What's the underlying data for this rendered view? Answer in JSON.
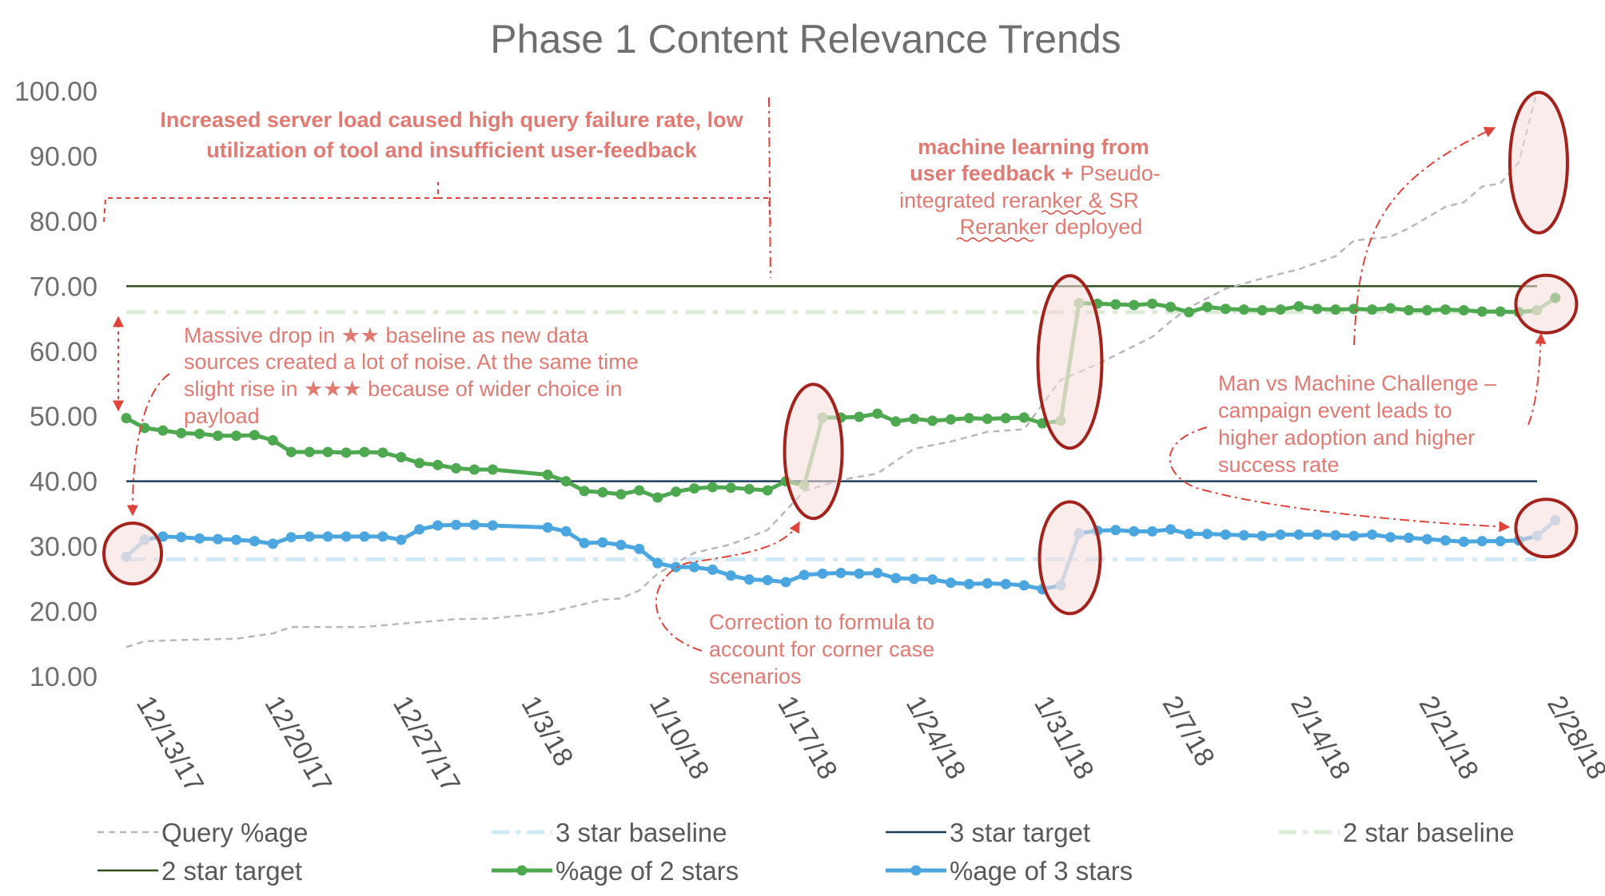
{
  "colors": {
    "query": "#b8b8b8",
    "star3_baseline": "#cfe9f6",
    "star3_target": "#1f3e5e",
    "star2_baseline": "#dcebd5",
    "star2_target": "#2d4d1d",
    "star2": "#4ea84f",
    "star2_light": "#9dcb93",
    "star3": "#4ba6e0",
    "star3_light": "#a8cfeb",
    "annotation": "#e07a72",
    "highlight_stroke": "#a3221c",
    "highlight_fill": "#f4dcdb"
  },
  "chart_data": {
    "type": "line",
    "title": "Phase 1 Content Relevance Trends",
    "xlabel": "",
    "ylabel": "",
    "ylim": [
      10,
      100
    ],
    "y_ticks": [
      "10.00",
      "20.00",
      "30.00",
      "40.00",
      "50.00",
      "60.00",
      "70.00",
      "80.00",
      "90.00",
      "100.00"
    ],
    "x_start": "2017-12-13",
    "x_end": "2018-02-28",
    "x_tick_labels": [
      "12/13/17",
      "12/20/17",
      "12/27/17",
      "1/3/18",
      "1/10/18",
      "1/17/18",
      "1/24/18",
      "1/31/18",
      "2/7/18",
      "2/14/18",
      "2/21/18",
      "2/28/18"
    ],
    "grid": false,
    "legend_position": "bottom",
    "series": [
      {
        "name": "Query %age",
        "style": "dashed",
        "points": [
          [
            "2017-12-13",
            14.5
          ],
          [
            "2017-12-14",
            15.4
          ],
          [
            "2017-12-16",
            15.6
          ],
          [
            "2017-12-19",
            15.8
          ],
          [
            "2017-12-21",
            16.6
          ],
          [
            "2017-12-22",
            17.6
          ],
          [
            "2017-12-26",
            17.6
          ],
          [
            "2017-12-28",
            18.1
          ],
          [
            "2017-12-31",
            18.8
          ],
          [
            "2018-01-02",
            18.9
          ],
          [
            "2018-01-05",
            19.8
          ],
          [
            "2018-01-08",
            21.8
          ],
          [
            "2018-01-09",
            22.0
          ],
          [
            "2018-01-10",
            23.2
          ],
          [
            "2018-01-11",
            25.8
          ],
          [
            "2018-01-13",
            29.0
          ],
          [
            "2018-01-15",
            30.3
          ],
          [
            "2018-01-17",
            32.5
          ],
          [
            "2018-01-19",
            38.5
          ],
          [
            "2018-01-21",
            40.2
          ],
          [
            "2018-01-23",
            41.2
          ],
          [
            "2018-01-25",
            45.0
          ],
          [
            "2018-01-27",
            46.1
          ],
          [
            "2018-01-29",
            47.6
          ],
          [
            "2018-01-31",
            48.0
          ],
          [
            "2018-02-02",
            55.6
          ],
          [
            "2018-02-04",
            58.0
          ],
          [
            "2018-02-05",
            59.4
          ],
          [
            "2018-02-07",
            62.2
          ],
          [
            "2018-02-08",
            64.6
          ],
          [
            "2018-02-09",
            66.7
          ],
          [
            "2018-02-11",
            69.6
          ],
          [
            "2018-02-13",
            71.2
          ],
          [
            "2018-02-15",
            72.6
          ],
          [
            "2018-02-17",
            74.6
          ],
          [
            "2018-02-18",
            77.0
          ],
          [
            "2018-02-20",
            77.6
          ],
          [
            "2018-02-21",
            78.9
          ],
          [
            "2018-02-23",
            82.2
          ],
          [
            "2018-02-24",
            82.9
          ],
          [
            "2018-02-25",
            85.3
          ],
          [
            "2018-02-26",
            85.8
          ],
          [
            "2018-02-27",
            89.0
          ],
          [
            "2018-02-28",
            100.0
          ]
        ]
      },
      {
        "name": "%age of 2 stars",
        "points": [
          [
            "2017-12-13",
            49.7
          ],
          [
            "2017-12-14",
            48.2
          ],
          [
            "2017-12-15",
            47.8
          ],
          [
            "2017-12-16",
            47.4
          ],
          [
            "2017-12-17",
            47.3
          ],
          [
            "2017-12-18",
            47.0
          ],
          [
            "2017-12-19",
            47.0
          ],
          [
            "2017-12-20",
            47.1
          ],
          [
            "2017-12-21",
            46.3
          ],
          [
            "2017-12-22",
            44.5
          ],
          [
            "2017-12-23",
            44.5
          ],
          [
            "2017-12-24",
            44.5
          ],
          [
            "2017-12-25",
            44.4
          ],
          [
            "2017-12-26",
            44.5
          ],
          [
            "2017-12-27",
            44.4
          ],
          [
            "2017-12-28",
            43.7
          ],
          [
            "2017-12-29",
            42.8
          ],
          [
            "2017-12-30",
            42.5
          ],
          [
            "2017-12-31",
            42.0
          ],
          [
            "2018-01-01",
            41.8
          ],
          [
            "2018-01-02",
            41.8
          ],
          [
            "2018-01-05",
            41.0
          ],
          [
            "2018-01-06",
            40.0
          ],
          [
            "2018-01-07",
            38.5
          ],
          [
            "2018-01-08",
            38.3
          ],
          [
            "2018-01-09",
            38.0
          ],
          [
            "2018-01-10",
            38.6
          ],
          [
            "2018-01-11",
            37.5
          ],
          [
            "2018-01-12",
            38.4
          ],
          [
            "2018-01-13",
            38.9
          ],
          [
            "2018-01-14",
            39.1
          ],
          [
            "2018-01-15",
            39.0
          ],
          [
            "2018-01-16",
            38.8
          ],
          [
            "2018-01-17",
            38.6
          ],
          [
            "2018-01-18",
            40.0
          ],
          [
            "2018-01-19",
            39.4
          ],
          [
            "2018-01-20",
            49.8
          ],
          [
            "2018-01-21",
            49.8
          ],
          [
            "2018-01-22",
            49.9
          ],
          [
            "2018-01-23",
            50.4
          ],
          [
            "2018-01-24",
            49.2
          ],
          [
            "2018-01-25",
            49.6
          ],
          [
            "2018-01-26",
            49.3
          ],
          [
            "2018-01-27",
            49.5
          ],
          [
            "2018-01-28",
            49.7
          ],
          [
            "2018-01-29",
            49.6
          ],
          [
            "2018-01-30",
            49.7
          ],
          [
            "2018-01-31",
            49.8
          ],
          [
            "2018-02-01",
            48.9
          ],
          [
            "2018-02-02",
            49.3
          ],
          [
            "2018-02-03",
            67.4
          ],
          [
            "2018-02-04",
            67.3
          ],
          [
            "2018-02-05",
            67.2
          ],
          [
            "2018-02-06",
            67.1
          ],
          [
            "2018-02-07",
            67.3
          ],
          [
            "2018-02-08",
            66.8
          ],
          [
            "2018-02-09",
            66.0
          ],
          [
            "2018-02-10",
            66.8
          ],
          [
            "2018-02-11",
            66.5
          ],
          [
            "2018-02-12",
            66.4
          ],
          [
            "2018-02-13",
            66.3
          ],
          [
            "2018-02-14",
            66.4
          ],
          [
            "2018-02-15",
            66.9
          ],
          [
            "2018-02-16",
            66.5
          ],
          [
            "2018-02-17",
            66.4
          ],
          [
            "2018-02-18",
            66.5
          ],
          [
            "2018-02-19",
            66.4
          ],
          [
            "2018-02-20",
            66.6
          ],
          [
            "2018-02-21",
            66.3
          ],
          [
            "2018-02-22",
            66.3
          ],
          [
            "2018-02-23",
            66.4
          ],
          [
            "2018-02-24",
            66.3
          ],
          [
            "2018-02-25",
            66.1
          ],
          [
            "2018-02-26",
            66.1
          ],
          [
            "2018-02-27",
            66.0
          ],
          [
            "2018-02-28",
            66.3
          ],
          [
            "2018-03-01",
            68.2
          ]
        ]
      },
      {
        "name": "%age of 3 stars",
        "points": [
          [
            "2017-12-13",
            28.4
          ],
          [
            "2017-12-14",
            31.0
          ],
          [
            "2017-12-15",
            31.5
          ],
          [
            "2017-12-16",
            31.4
          ],
          [
            "2017-12-17",
            31.2
          ],
          [
            "2017-12-18",
            31.1
          ],
          [
            "2017-12-19",
            31.0
          ],
          [
            "2017-12-20",
            30.8
          ],
          [
            "2017-12-21",
            30.4
          ],
          [
            "2017-12-22",
            31.4
          ],
          [
            "2017-12-23",
            31.5
          ],
          [
            "2017-12-24",
            31.5
          ],
          [
            "2017-12-25",
            31.5
          ],
          [
            "2017-12-26",
            31.5
          ],
          [
            "2017-12-27",
            31.5
          ],
          [
            "2017-12-28",
            31.0
          ],
          [
            "2017-12-29",
            32.6
          ],
          [
            "2017-12-30",
            33.2
          ],
          [
            "2017-12-31",
            33.3
          ],
          [
            "2018-01-01",
            33.3
          ],
          [
            "2018-01-02",
            33.2
          ],
          [
            "2018-01-05",
            32.9
          ],
          [
            "2018-01-06",
            32.3
          ],
          [
            "2018-01-07",
            30.5
          ],
          [
            "2018-01-08",
            30.6
          ],
          [
            "2018-01-09",
            30.2
          ],
          [
            "2018-01-10",
            29.6
          ],
          [
            "2018-01-11",
            27.4
          ],
          [
            "2018-01-12",
            26.8
          ],
          [
            "2018-01-13",
            26.8
          ],
          [
            "2018-01-14",
            26.4
          ],
          [
            "2018-01-15",
            25.5
          ],
          [
            "2018-01-16",
            24.9
          ],
          [
            "2018-01-17",
            24.8
          ],
          [
            "2018-01-18",
            24.5
          ],
          [
            "2018-01-19",
            25.6
          ],
          [
            "2018-01-20",
            25.8
          ],
          [
            "2018-01-21",
            25.9
          ],
          [
            "2018-01-22",
            25.8
          ],
          [
            "2018-01-23",
            25.9
          ],
          [
            "2018-01-24",
            25.1
          ],
          [
            "2018-01-25",
            25.0
          ],
          [
            "2018-01-26",
            24.9
          ],
          [
            "2018-01-27",
            24.4
          ],
          [
            "2018-01-28",
            24.2
          ],
          [
            "2018-01-29",
            24.3
          ],
          [
            "2018-01-30",
            24.2
          ],
          [
            "2018-01-31",
            24.0
          ],
          [
            "2018-02-01",
            23.4
          ],
          [
            "2018-02-02",
            24.0
          ],
          [
            "2018-02-03",
            32.0
          ],
          [
            "2018-02-04",
            32.4
          ],
          [
            "2018-02-05",
            32.5
          ],
          [
            "2018-02-06",
            32.3
          ],
          [
            "2018-02-07",
            32.3
          ],
          [
            "2018-02-08",
            32.6
          ],
          [
            "2018-02-09",
            31.9
          ],
          [
            "2018-02-10",
            31.9
          ],
          [
            "2018-02-11",
            31.8
          ],
          [
            "2018-02-12",
            31.7
          ],
          [
            "2018-02-13",
            31.6
          ],
          [
            "2018-02-14",
            31.8
          ],
          [
            "2018-02-15",
            31.8
          ],
          [
            "2018-02-16",
            31.8
          ],
          [
            "2018-02-17",
            31.7
          ],
          [
            "2018-02-18",
            31.6
          ],
          [
            "2018-02-19",
            31.8
          ],
          [
            "2018-02-20",
            31.4
          ],
          [
            "2018-02-21",
            31.3
          ],
          [
            "2018-02-22",
            31.1
          ],
          [
            "2018-02-23",
            30.9
          ],
          [
            "2018-02-24",
            30.7
          ],
          [
            "2018-02-25",
            30.8
          ],
          [
            "2018-02-26",
            30.8
          ],
          [
            "2018-02-27",
            30.9
          ],
          [
            "2018-02-28",
            31.6
          ],
          [
            "2018-03-01",
            34.0
          ]
        ]
      },
      {
        "name": "3 star baseline",
        "style": "dash-dot",
        "constant": 28
      },
      {
        "name": "3 star target",
        "style": "solid",
        "constant": 40
      },
      {
        "name": "2 star baseline",
        "style": "dash-dot",
        "constant": 66
      },
      {
        "name": "2 star target",
        "style": "solid",
        "constant": 70
      }
    ],
    "legend": [
      "Query %age",
      "3 star baseline",
      "3 star target",
      "2 star baseline",
      "2 star target",
      "%age of 2 stars",
      "%age of 3 stars"
    ],
    "annotations": {
      "server_load": [
        "Increased server load caused high query failure rate, low",
        "utilization of tool and insufficient user-feedback"
      ],
      "ml_bold": [
        "machine learning from",
        "user feedback +"
      ],
      "ml_rest": [
        "Pseudo-",
        "integrated",
        "reranker",
        "& SR",
        "Reranker",
        "deployed"
      ],
      "massive_drop": [
        "Massive drop in ★★ baseline as new data",
        "sources created a lot of noise. At the same time",
        "slight rise in ★★★ because of wider choice in",
        "payload"
      ],
      "correction": [
        "Correction to formula to",
        "account for corner case",
        "scenarios"
      ],
      "man_vs_machine": [
        "Man vs Machine Challenge –",
        "campaign event leads to",
        "higher adoption and higher",
        "success rate"
      ]
    }
  }
}
